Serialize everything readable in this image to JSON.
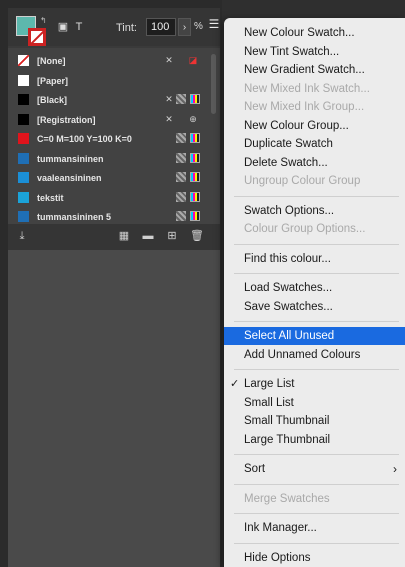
{
  "panel": {
    "tint_label": "Tint:",
    "tint_value": "100",
    "tint_unit": "%",
    "text_mode_label": "T",
    "swatches": [
      {
        "name": "[None]",
        "chip": "#ffffff",
        "kind": "none"
      },
      {
        "name": "[Paper]",
        "chip": "#ffffff",
        "kind": "paper"
      },
      {
        "name": "[Black]",
        "chip": "#000000",
        "kind": "black"
      },
      {
        "name": "[Registration]",
        "chip": "#000000",
        "kind": "registration"
      },
      {
        "name": "C=0 M=100 Y=100 K=0",
        "chip": "#e0141c",
        "kind": "process"
      },
      {
        "name": "tummansininen",
        "chip": "#1f6fb5",
        "kind": "process"
      },
      {
        "name": "vaaleansininen",
        "chip": "#1b8fd6",
        "kind": "process"
      },
      {
        "name": "tekstit",
        "chip": "#1ba3d9",
        "kind": "process"
      },
      {
        "name": "tummansininen 5",
        "chip": "#1f6fb5",
        "kind": "process"
      }
    ]
  },
  "menu": {
    "items": [
      {
        "label": "New Colour Swatch...",
        "state": "enabled"
      },
      {
        "label": "New Tint Swatch...",
        "state": "enabled"
      },
      {
        "label": "New Gradient Swatch...",
        "state": "enabled"
      },
      {
        "label": "New Mixed Ink Swatch...",
        "state": "disabled"
      },
      {
        "label": "New Mixed Ink Group...",
        "state": "disabled"
      },
      {
        "label": "New Colour Group...",
        "state": "enabled"
      },
      {
        "label": "Duplicate Swatch",
        "state": "enabled"
      },
      {
        "label": "Delete Swatch...",
        "state": "enabled"
      },
      {
        "label": "Ungroup Colour Group",
        "state": "disabled"
      },
      {
        "label": "Swatch Options...",
        "state": "enabled"
      },
      {
        "label": "Colour Group Options...",
        "state": "disabled"
      },
      {
        "label": "Find this colour...",
        "state": "enabled"
      },
      {
        "label": "Load Swatches...",
        "state": "enabled"
      },
      {
        "label": "Save Swatches...",
        "state": "enabled"
      },
      {
        "label": "Select All Unused",
        "state": "selected"
      },
      {
        "label": "Add Unnamed Colours",
        "state": "enabled"
      },
      {
        "label": "Large List",
        "state": "enabled",
        "checked": true
      },
      {
        "label": "Small List",
        "state": "enabled"
      },
      {
        "label": "Small Thumbnail",
        "state": "enabled"
      },
      {
        "label": "Large Thumbnail",
        "state": "enabled"
      },
      {
        "label": "Sort",
        "state": "enabled",
        "submenu": true
      },
      {
        "label": "Merge Swatches",
        "state": "disabled"
      },
      {
        "label": "Ink Manager...",
        "state": "enabled"
      },
      {
        "label": "Hide Options",
        "state": "enabled"
      }
    ],
    "check_glyph": "✓",
    "submenu_glyph": "›"
  }
}
